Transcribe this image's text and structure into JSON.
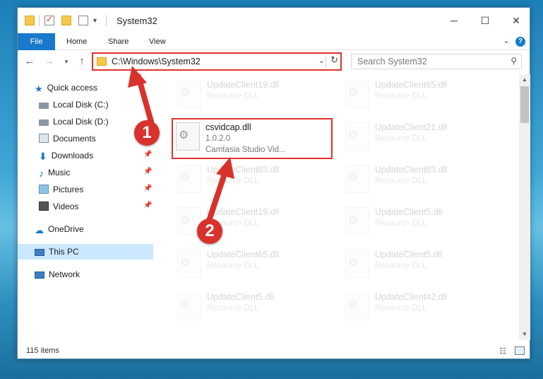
{
  "window": {
    "title": "System32",
    "controls": {
      "minimize": "─",
      "maximize": "☐",
      "close": "✕"
    }
  },
  "ribbon": {
    "tabs": [
      "File",
      "Home",
      "Share",
      "View"
    ],
    "help": "?"
  },
  "address": {
    "path": "C:\\Windows\\System32",
    "search_placeholder": "Search System32"
  },
  "sidebar": {
    "items": [
      {
        "label": "Quick access",
        "icon": "star-icon",
        "pinned": false
      },
      {
        "label": "Local Disk (C:)",
        "icon": "drive-icon",
        "pinned": false
      },
      {
        "label": "Local Disk (D:)",
        "icon": "drive-icon",
        "pinned": false
      },
      {
        "label": "Documents",
        "icon": "documents-icon",
        "pinned": true
      },
      {
        "label": "Downloads",
        "icon": "download-icon",
        "pinned": true
      },
      {
        "label": "Music",
        "icon": "music-icon",
        "pinned": true
      },
      {
        "label": "Pictures",
        "icon": "pictures-icon",
        "pinned": true
      },
      {
        "label": "Videos",
        "icon": "videos-icon",
        "pinned": true
      },
      {
        "label": "OneDrive",
        "icon": "cloud-icon",
        "pinned": false
      },
      {
        "label": "This PC",
        "icon": "pc-icon",
        "pinned": false,
        "selected": true
      },
      {
        "label": "Network",
        "icon": "network-icon",
        "pinned": false
      }
    ]
  },
  "files": [
    {
      "name": "UpdateClient19.dll",
      "line1": "Resource DLL",
      "line2": ""
    },
    {
      "name": "UpdateClient65.dll",
      "line1": "Resource DLL",
      "line2": ""
    },
    {
      "name": "csvidcap.dll",
      "line1": "1.0.2.0",
      "line2": "Camtasia Studio Vid...",
      "highlighted": true
    },
    {
      "name": "UpdateClient21.dll",
      "line1": "Resource DLL",
      "line2": ""
    },
    {
      "name": "UpdateClient63.dll",
      "line1": "Resource DLL",
      "line2": ""
    },
    {
      "name": "UpdateClient63.dll",
      "line1": "Resource DLL",
      "line2": ""
    },
    {
      "name": "UpdateClient19.dll",
      "line1": "Resource DLL",
      "line2": ""
    },
    {
      "name": "UpdateClient5.dll",
      "line1": "Resource DLL",
      "line2": ""
    },
    {
      "name": "UpdateClient65.dll",
      "line1": "Resource DLL",
      "line2": ""
    },
    {
      "name": "UpdateClient5.dll",
      "line1": "Resource DLL",
      "line2": ""
    },
    {
      "name": "UpdateClient5.dll",
      "line1": "Resource DLL",
      "line2": ""
    },
    {
      "name": "UpdateClient42.dll",
      "line1": "Resource DLL",
      "line2": ""
    }
  ],
  "status": {
    "count": "115 items"
  },
  "annotations": {
    "badge1": "1",
    "badge2": "2",
    "color": "#d9312c"
  },
  "colors": {
    "accent": "#1979ca",
    "highlight": "#e0322f",
    "selected": "#cce8ff"
  }
}
